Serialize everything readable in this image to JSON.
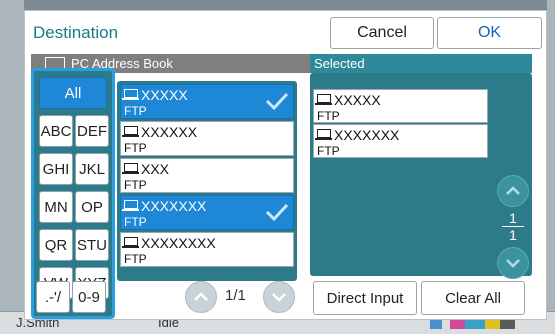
{
  "dialog": {
    "title": "Destination",
    "cancel_label": "Cancel",
    "ok_label": "OK"
  },
  "address_book": {
    "header": "PC Address Book",
    "filters": [
      "All",
      "ABC",
      "DEF",
      "GHI",
      "JKL",
      "MN",
      "OP",
      "QR",
      "STU",
      "VW",
      "XYZ",
      ".-'/",
      "0-9"
    ],
    "active_filter": "All",
    "items": [
      {
        "name": "XXXXX",
        "protocol": "FTP",
        "selected": true
      },
      {
        "name": "XXXXXX",
        "protocol": "FTP",
        "selected": false
      },
      {
        "name": "XXX",
        "protocol": "FTP",
        "selected": false
      },
      {
        "name": "XXXXXXX",
        "protocol": "FTP",
        "selected": true
      },
      {
        "name": "XXXXXXXX",
        "protocol": "FTP",
        "selected": false
      }
    ],
    "page_indicator": "1/1"
  },
  "selected": {
    "header": "Selected",
    "items": [
      {
        "name": "XXXXX",
        "protocol": "FTP"
      },
      {
        "name": "XXXXXXX",
        "protocol": "FTP"
      }
    ],
    "page_current": "1",
    "page_total": "1"
  },
  "actions": {
    "direct_input": "Direct Input",
    "clear_all": "Clear All"
  },
  "status_bar": {
    "user": "J.Smith",
    "state": "Idle"
  },
  "colors": {
    "accent_blue": "#1e88d6",
    "panel_teal": "#2d7a8a",
    "highlight_frame": "#2a9fe0"
  }
}
